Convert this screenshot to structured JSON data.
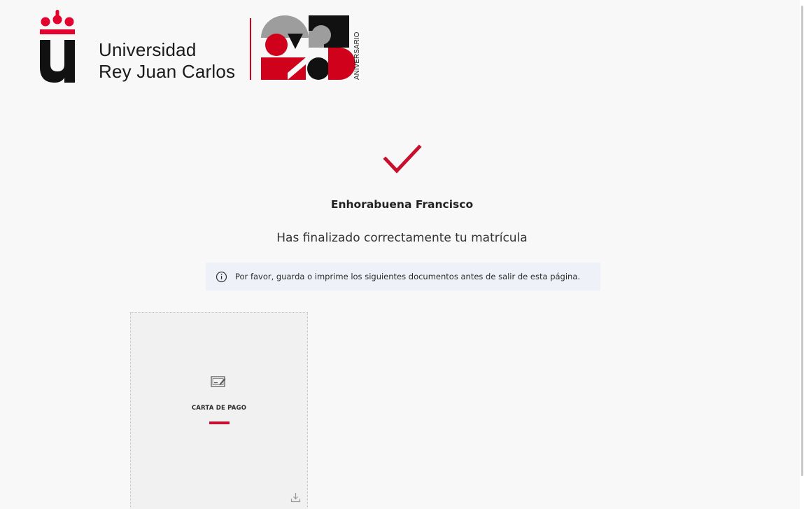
{
  "header": {
    "university_line1": "Universidad",
    "university_line2": "Rey Juan Carlos",
    "anniversary_label": "ANIVERSARIO",
    "logo_icon": "urjc-logo-icon",
    "anniversary_icon": "25-aniversario-icon"
  },
  "success": {
    "icon": "checkmark-icon",
    "title": "Enhorabuena Francisco",
    "subtitle": "Has finalizado correctamente tu matrícula"
  },
  "notice": {
    "icon": "info-icon",
    "text": "Por favor, guarda o imprime los siguientes documentos antes de salir de esta página."
  },
  "documents": [
    {
      "icon": "payment-document-icon",
      "label": "CARTA DE PAGO",
      "action_icon": "download-icon"
    }
  ],
  "colors": {
    "accent_red": "#c8102e",
    "background": "#f8f8f8",
    "notice_background": "#eef2f8",
    "card_background": "#f1f1f1"
  }
}
